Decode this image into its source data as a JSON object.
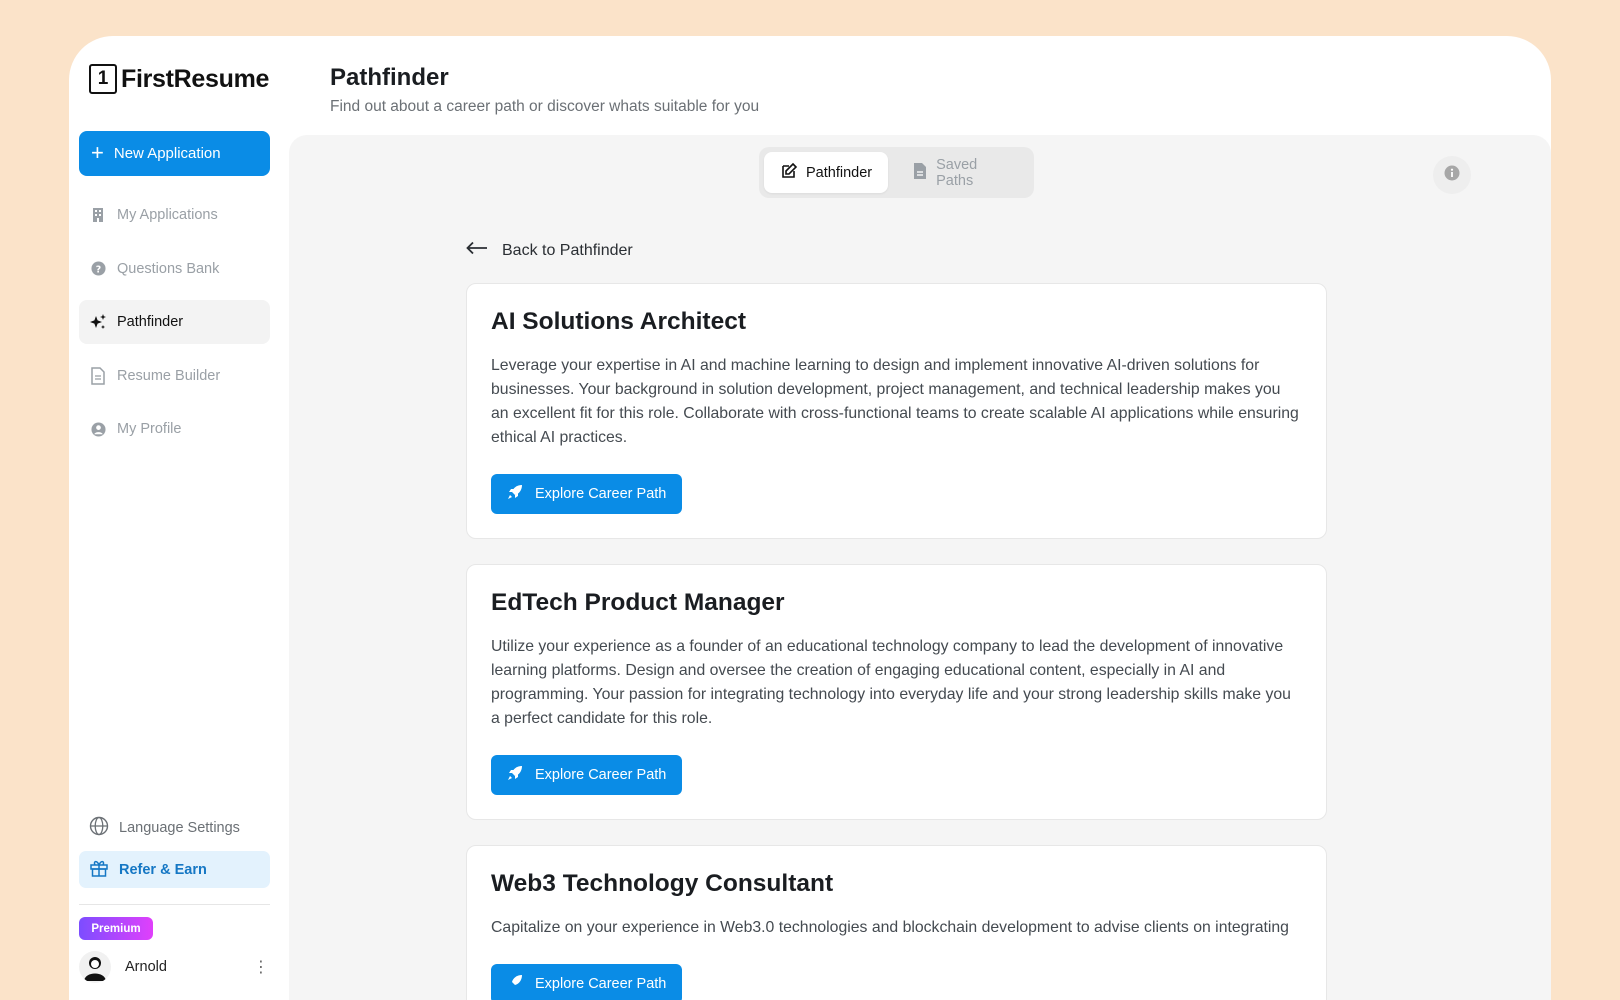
{
  "brand": {
    "logo_mark": "1",
    "name": "FirstResume"
  },
  "sidebar": {
    "new_application_label": "New Application",
    "items": [
      {
        "label": "My Applications",
        "icon": "building-icon"
      },
      {
        "label": "Questions Bank",
        "icon": "question-circle-icon"
      },
      {
        "label": "Pathfinder",
        "icon": "sparkles-icon",
        "active": true
      },
      {
        "label": "Resume Builder",
        "icon": "document-icon"
      },
      {
        "label": "My Profile",
        "icon": "user-circle-icon"
      }
    ],
    "language_settings_label": "Language Settings",
    "refer_label": "Refer & Earn",
    "premium_badge": "Premium",
    "user_name": "Arnold"
  },
  "header": {
    "title": "Pathfinder",
    "subtitle": "Find out about a career path or discover whats suitable for you"
  },
  "tabs": [
    {
      "label": "Pathfinder",
      "icon": "edit-icon",
      "active": true
    },
    {
      "label": "Saved Paths",
      "icon": "file-icon",
      "active": false
    }
  ],
  "back_link_label": "Back to Pathfinder",
  "careers": [
    {
      "title": "AI Solutions Architect",
      "description": "Leverage your expertise in AI and machine learning to design and implement innovative AI-driven solutions for businesses. Your background in solution development, project management, and technical leadership makes you an excellent fit for this role. Collaborate with cross-functional teams to create scalable AI applications while ensuring ethical AI practices.",
      "button_label": "Explore Career Path"
    },
    {
      "title": "EdTech Product Manager",
      "description": "Utilize your experience as a founder of an educational technology company to lead the development of innovative learning platforms. Design and oversee the creation of engaging educational content, especially in AI and programming. Your passion for integrating technology into everyday life and your strong leadership skills make you a perfect candidate for this role.",
      "button_label": "Explore Career Path"
    },
    {
      "title": "Web3 Technology Consultant",
      "description": "Capitalize on your experience in Web3.0 technologies and blockchain development to advise clients on integrating",
      "button_label": "Explore Career Path"
    }
  ],
  "colors": {
    "primary": "#0a8ce6",
    "page_background": "#fbe3c9",
    "panel_background": "#f5f5f5",
    "refer_background": "#e3f2fd"
  }
}
